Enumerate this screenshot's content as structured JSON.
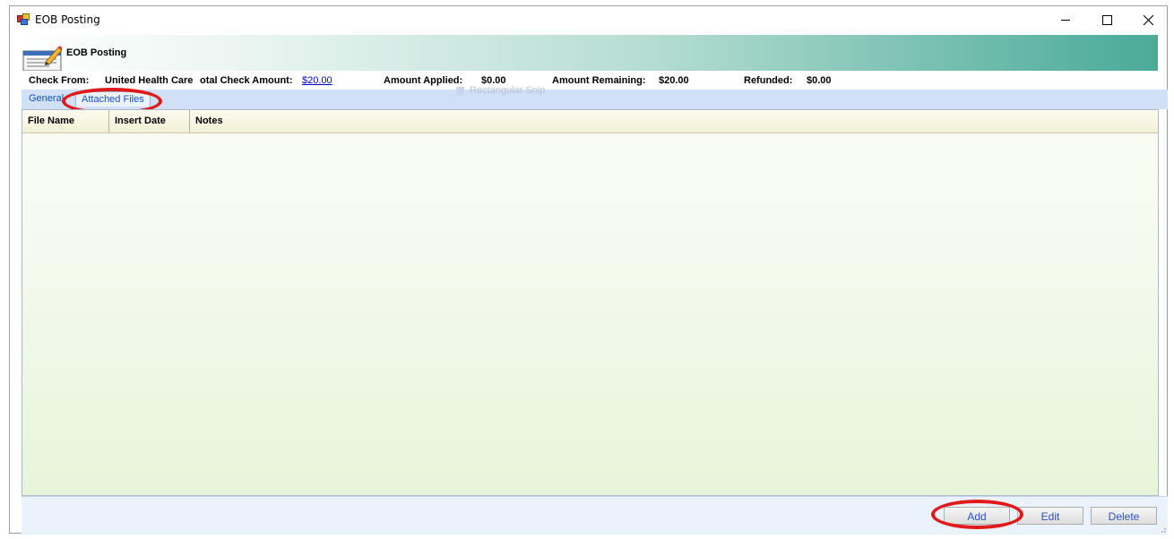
{
  "window": {
    "title": "EOB Posting",
    "controls": {
      "minimize": "minimize-icon",
      "maximize": "maximize-icon",
      "close": "close-icon"
    }
  },
  "header": {
    "title": "EOB Posting",
    "icon": "document-pencil-icon",
    "gradient_colors": [
      "#ffffff",
      "#4aaa98"
    ]
  },
  "summary": {
    "check_from_label": "Check From:",
    "check_from_value": "United Health Care",
    "total_check_label": "otal Check Amount:",
    "total_check_value": "$20.00",
    "applied_label": "Amount Applied:",
    "applied_value": "$0.00",
    "remaining_label": "Amount Remaining:",
    "remaining_value": "$20.00",
    "refunded_label": "Refunded:",
    "refunded_value": "$0.00",
    "ghost_overlay": "Rectangular Snip"
  },
  "tabs": [
    {
      "label": "General",
      "active": false
    },
    {
      "label": "Attached Files",
      "active": true
    }
  ],
  "grid": {
    "columns": [
      "File Name",
      "Insert Date",
      "Notes"
    ],
    "rows": []
  },
  "buttons": {
    "add": "Add",
    "edit": "Edit",
    "delete": "Delete"
  },
  "annotations": {
    "highlight_color": "#e01a1a"
  }
}
